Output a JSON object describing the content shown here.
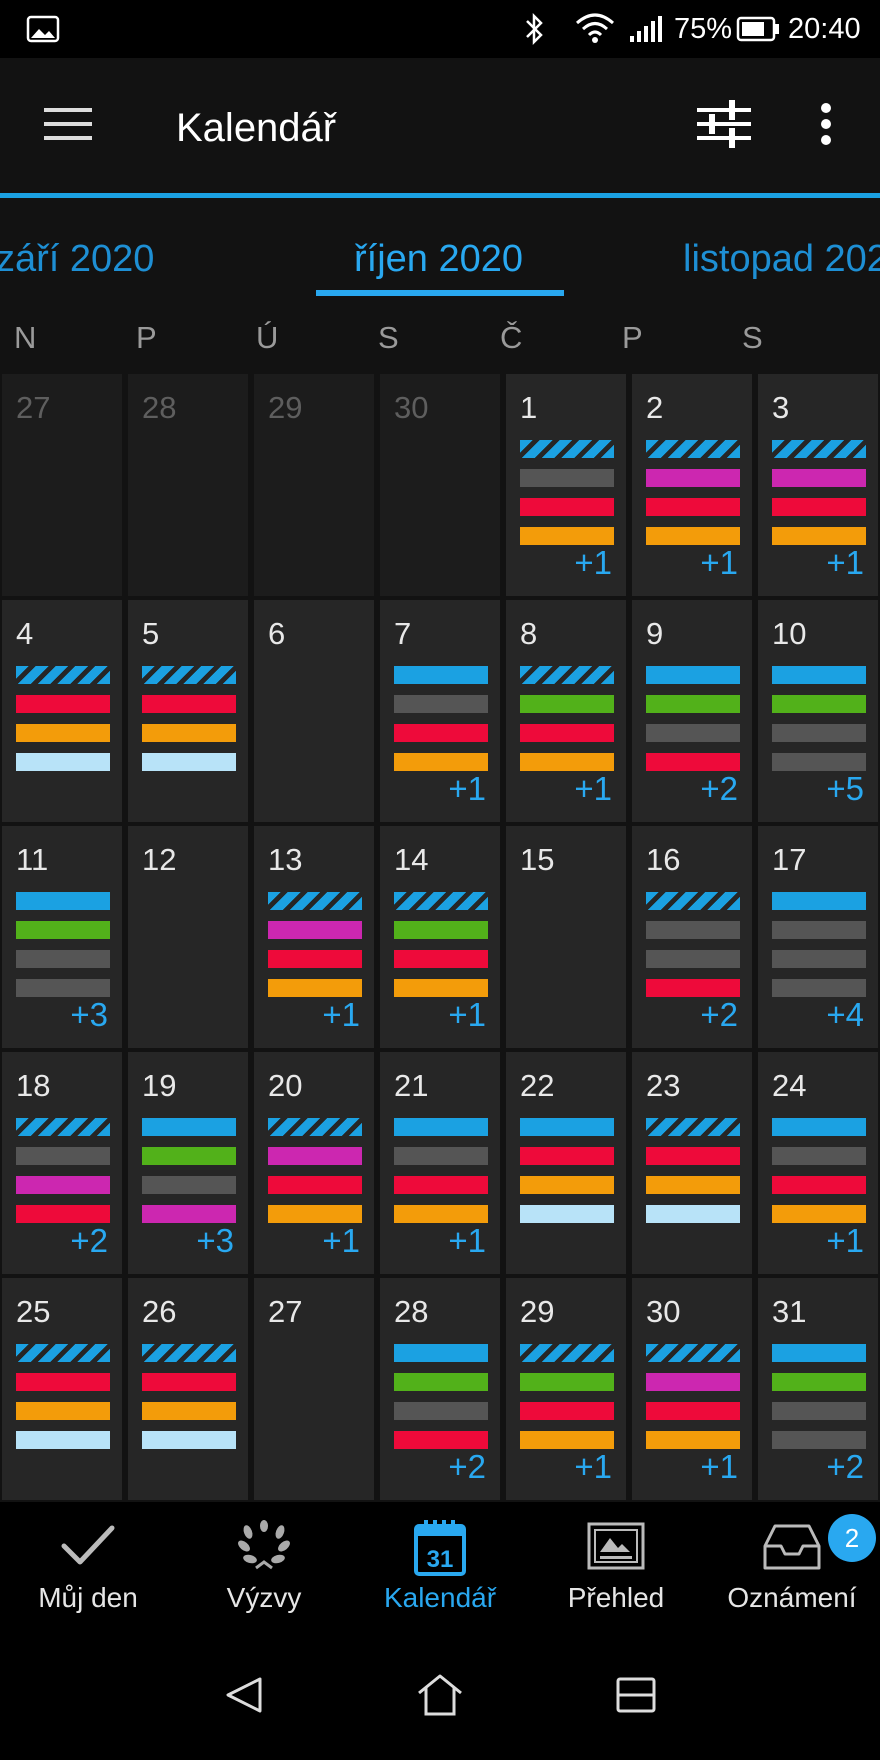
{
  "status_bar": {
    "battery": "75%",
    "time": "20:40"
  },
  "app_bar": {
    "title": "Kalendář"
  },
  "months": {
    "prev": "září 2020",
    "current": "říjen 2020",
    "next": "listopad 2020"
  },
  "weekdays": [
    "N",
    "P",
    "Ú",
    "S",
    "Č",
    "P",
    "S"
  ],
  "colors": {
    "accent": "#29a8f0",
    "blue": "#1ba1e2",
    "gray": "#555555",
    "red": "#ee0a3a",
    "orange": "#f39c0a",
    "magenta": "#cc27b0",
    "green": "#52b11a",
    "lightblue": "#b8e3f8"
  },
  "calendar": {
    "weeks": [
      [
        {
          "day": "27",
          "outside": true,
          "bars": []
        },
        {
          "day": "28",
          "outside": true,
          "bars": []
        },
        {
          "day": "29",
          "outside": true,
          "bars": []
        },
        {
          "day": "30",
          "outside": true,
          "bars": []
        },
        {
          "day": "1",
          "bars": [
            "striped",
            "gray",
            "red",
            "orange"
          ],
          "more": "+1"
        },
        {
          "day": "2",
          "bars": [
            "striped",
            "magenta",
            "red",
            "orange"
          ],
          "more": "+1"
        },
        {
          "day": "3",
          "bars": [
            "striped",
            "magenta",
            "red",
            "orange"
          ],
          "more": "+1"
        }
      ],
      [
        {
          "day": "4",
          "bars": [
            "striped",
            "red",
            "orange",
            "lightblue"
          ]
        },
        {
          "day": "5",
          "bars": [
            "striped",
            "red",
            "orange",
            "lightblue"
          ]
        },
        {
          "day": "6",
          "bars": []
        },
        {
          "day": "7",
          "bars": [
            "blue",
            "gray",
            "red",
            "orange"
          ],
          "more": "+1"
        },
        {
          "day": "8",
          "bars": [
            "striped",
            "green",
            "red",
            "orange"
          ],
          "more": "+1"
        },
        {
          "day": "9",
          "bars": [
            "blue",
            "green",
            "gray",
            "red"
          ],
          "more": "+2"
        },
        {
          "day": "10",
          "bars": [
            "blue",
            "green",
            "gray",
            "gray"
          ],
          "more": "+5"
        }
      ],
      [
        {
          "day": "11",
          "bars": [
            "blue",
            "green",
            "gray",
            "gray"
          ],
          "more": "+3"
        },
        {
          "day": "12",
          "bars": []
        },
        {
          "day": "13",
          "bars": [
            "striped",
            "magenta",
            "red",
            "orange"
          ],
          "more": "+1"
        },
        {
          "day": "14",
          "bars": [
            "striped",
            "green",
            "red",
            "orange"
          ],
          "more": "+1"
        },
        {
          "day": "15",
          "bars": []
        },
        {
          "day": "16",
          "bars": [
            "striped",
            "gray",
            "gray",
            "red"
          ],
          "more": "+2"
        },
        {
          "day": "17",
          "bars": [
            "blue",
            "gray",
            "gray",
            "gray"
          ],
          "more": "+4"
        }
      ],
      [
        {
          "day": "18",
          "bars": [
            "striped",
            "gray",
            "magenta",
            "red"
          ],
          "more": "+2"
        },
        {
          "day": "19",
          "bars": [
            "blue",
            "green",
            "gray",
            "magenta"
          ],
          "more": "+3"
        },
        {
          "day": "20",
          "bars": [
            "striped",
            "magenta",
            "red",
            "orange"
          ],
          "more": "+1"
        },
        {
          "day": "21",
          "bars": [
            "blue",
            "gray",
            "red",
            "orange"
          ],
          "more": "+1"
        },
        {
          "day": "22",
          "bars": [
            "blue",
            "red",
            "orange",
            "lightblue"
          ]
        },
        {
          "day": "23",
          "bars": [
            "striped",
            "red",
            "orange",
            "lightblue"
          ]
        },
        {
          "day": "24",
          "bars": [
            "blue",
            "gray",
            "red",
            "orange"
          ],
          "more": "+1"
        }
      ],
      [
        {
          "day": "25",
          "bars": [
            "striped",
            "red",
            "orange",
            "lightblue"
          ]
        },
        {
          "day": "26",
          "bars": [
            "striped",
            "red",
            "orange",
            "lightblue"
          ]
        },
        {
          "day": "27",
          "bars": []
        },
        {
          "day": "28",
          "bars": [
            "blue",
            "green",
            "gray",
            "red"
          ],
          "more": "+2"
        },
        {
          "day": "29",
          "bars": [
            "striped",
            "green",
            "red",
            "orange"
          ],
          "more": "+1"
        },
        {
          "day": "30",
          "bars": [
            "striped",
            "magenta",
            "red",
            "orange"
          ],
          "more": "+1"
        },
        {
          "day": "31",
          "bars": [
            "blue",
            "green",
            "gray",
            "gray"
          ],
          "more": "+2"
        }
      ]
    ]
  },
  "bottom_nav": {
    "items": [
      {
        "label": "Můj den",
        "icon": "checkmark-icon"
      },
      {
        "label": "Výzvy",
        "icon": "laurel-icon"
      },
      {
        "label": "Kalendář",
        "icon": "calendar-icon",
        "icon_text": "31",
        "active": true
      },
      {
        "label": "Přehled",
        "icon": "newspaper-icon"
      },
      {
        "label": "Oznámení",
        "icon": "inbox-icon"
      }
    ],
    "badge": "2"
  }
}
